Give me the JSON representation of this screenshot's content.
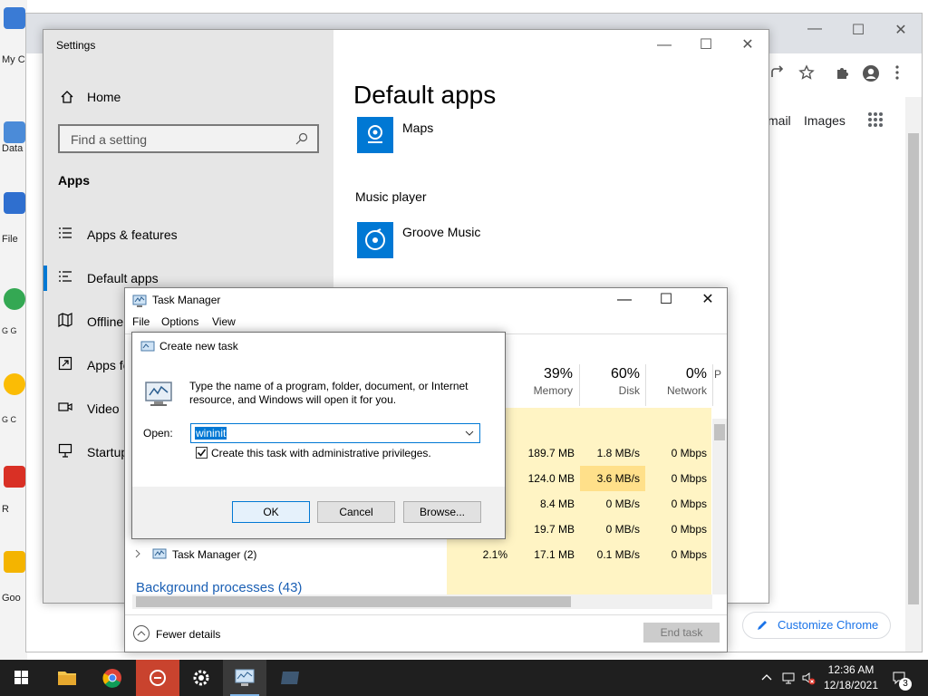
{
  "desktop": {
    "icons": [
      {
        "label": "My C"
      },
      {
        "label": "Data"
      },
      {
        "label": "File"
      },
      {
        "label": "G G"
      },
      {
        "label": "G C"
      },
      {
        "label": "R"
      },
      {
        "label": "Goo"
      }
    ]
  },
  "chrome": {
    "gmail_partial": "mail",
    "images_label": "Images",
    "customize_label": "Customize Chrome"
  },
  "settings": {
    "window_title": "Settings",
    "home_label": "Home",
    "search_placeholder": "Find a setting",
    "section_heading": "Apps",
    "nav": [
      {
        "label": "Apps & features",
        "icon": "list-icon"
      },
      {
        "label": "Default apps",
        "icon": "default-apps-icon",
        "active": true
      },
      {
        "label": "Offline",
        "icon": "map-icon"
      },
      {
        "label": "Apps fo",
        "icon": "open-in-icon"
      },
      {
        "label": "Video",
        "icon": "video-icon"
      },
      {
        "label": "Startup",
        "icon": "startup-icon"
      }
    ],
    "page_title": "Default apps",
    "maps_app": "Maps",
    "music_section": "Music player",
    "music_app": "Groove Music",
    "accent": "#0078d4"
  },
  "taskmgr": {
    "title": "Task Manager",
    "menu": [
      "File",
      "Options",
      "View"
    ],
    "columns": [
      {
        "pct": "39%",
        "name": "Memory"
      },
      {
        "pct": "60%",
        "name": "Disk"
      },
      {
        "pct": "0%",
        "name": "Network"
      },
      {
        "pct": "",
        "name": "P"
      }
    ],
    "rows": [
      {
        "cpu": "",
        "memory": "189.7 MB",
        "disk": "1.8 MB/s",
        "network": "0 Mbps"
      },
      {
        "cpu": "",
        "memory": "124.0 MB",
        "disk": "3.6 MB/s",
        "network": "0 Mbps"
      },
      {
        "cpu": "",
        "memory": "8.4 MB",
        "disk": "0 MB/s",
        "network": "0 Mbps"
      },
      {
        "cpu": "",
        "memory": "19.7 MB",
        "disk": "0 MB/s",
        "network": "0 Mbps"
      },
      {
        "name": "Task Manager (2)",
        "cpu": "2.1%",
        "memory": "17.1 MB",
        "disk": "0.1 MB/s",
        "network": "0 Mbps"
      }
    ],
    "background_processes": "Background processes (43)",
    "fewer_details": "Fewer details",
    "end_task": "End task"
  },
  "new_task": {
    "title": "Create new task",
    "description": "Type the name of a program, folder, document, or Internet resource, and Windows will open it for you.",
    "open_label": "Open:",
    "open_value": "wininit",
    "admin_label": "Create this task with administrative privileges.",
    "admin_checked": true,
    "ok": "OK",
    "cancel": "Cancel",
    "browse": "Browse..."
  },
  "taskbar": {
    "time": "12:36 AM",
    "date": "12/18/2021",
    "notification_count": "3"
  }
}
